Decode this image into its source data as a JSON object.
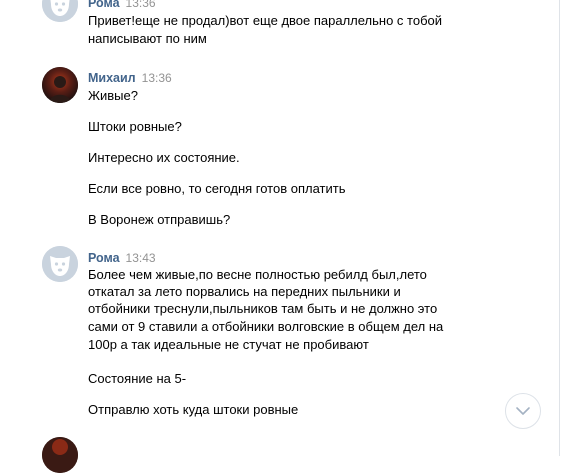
{
  "messages": [
    {
      "author": "Рома",
      "time": "13:36",
      "paragraphs": [
        "Привет!еще не продал)вот еще двое параллельно с тобой",
        "написывают по ним"
      ]
    },
    {
      "author": "Михаил",
      "time": "13:36",
      "paragraphs": [
        "Живые?",
        "Штоки ровные?",
        "Интересно их состояние.",
        "Если все ровно, то сегодня готов оплатить",
        "В Воронеж отправишь?"
      ]
    },
    {
      "author": "Рома",
      "time": "13:43",
      "paragraphs": [
        "Более чем живые,по весне полностью ребилд был,лето",
        "откатал за лето порвались на передних пыльники и",
        "отбойники треснули,пыльников там быть и не должно это",
        "сами от 9 ставили а отбойники волговские в общем дел на",
        "100р а так идеальные не стучат не пробивают",
        "Состояние на 5-",
        "Отправлю хоть куда штоки ровные"
      ]
    }
  ],
  "icons": {
    "dog_avatar": "dog-avatar-icon",
    "scroll_down": "chevron-down-icon"
  },
  "colors": {
    "author_name": "#42648b",
    "timestamp": "#939393",
    "avatar_default_bg": "#c9d3de"
  }
}
